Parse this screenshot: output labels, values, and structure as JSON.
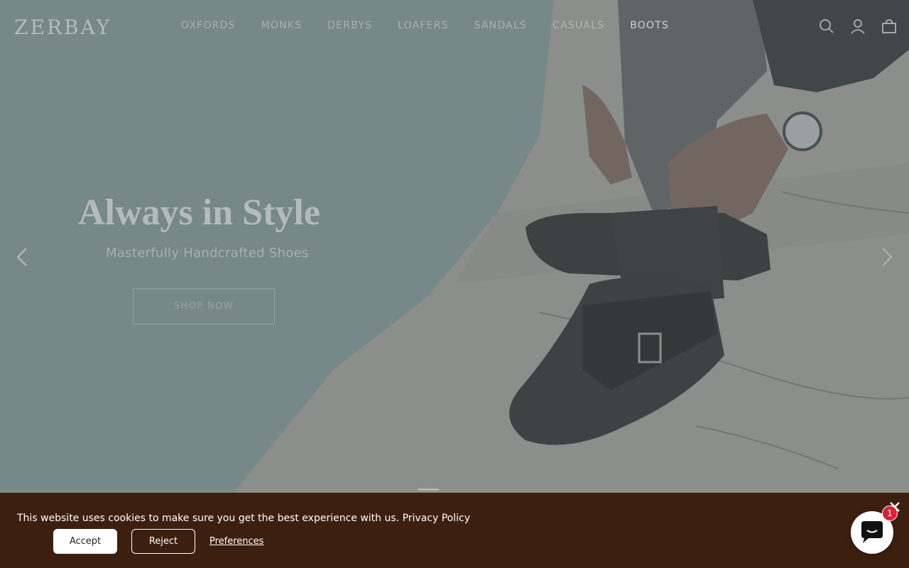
{
  "brand": {
    "logo": "ZERBAY"
  },
  "nav": {
    "items": [
      "OXFORDS",
      "MONKS",
      "DERBYS",
      "LOAFERS",
      "SANDALS",
      "CASUALS",
      "BOOTS"
    ]
  },
  "header_icons": [
    "search-icon",
    "account-icon",
    "cart-icon"
  ],
  "hero": {
    "headline": "Always in Style",
    "subline": "Masterfully Handcrafted Shoes",
    "cta_label": "SHOP NOW",
    "slide_count_indicator": "1"
  },
  "cookie_bar": {
    "message": "This website uses cookies to make sure you get the best experience with us.",
    "policy_link": "Privacy Policy",
    "accept_label": "Accept",
    "reject_label": "Reject",
    "preferences_label": "Preferences",
    "background_color": "#3d1f10"
  },
  "chat_widget": {
    "badge_count": "1",
    "badge_color": "#d6223a"
  }
}
